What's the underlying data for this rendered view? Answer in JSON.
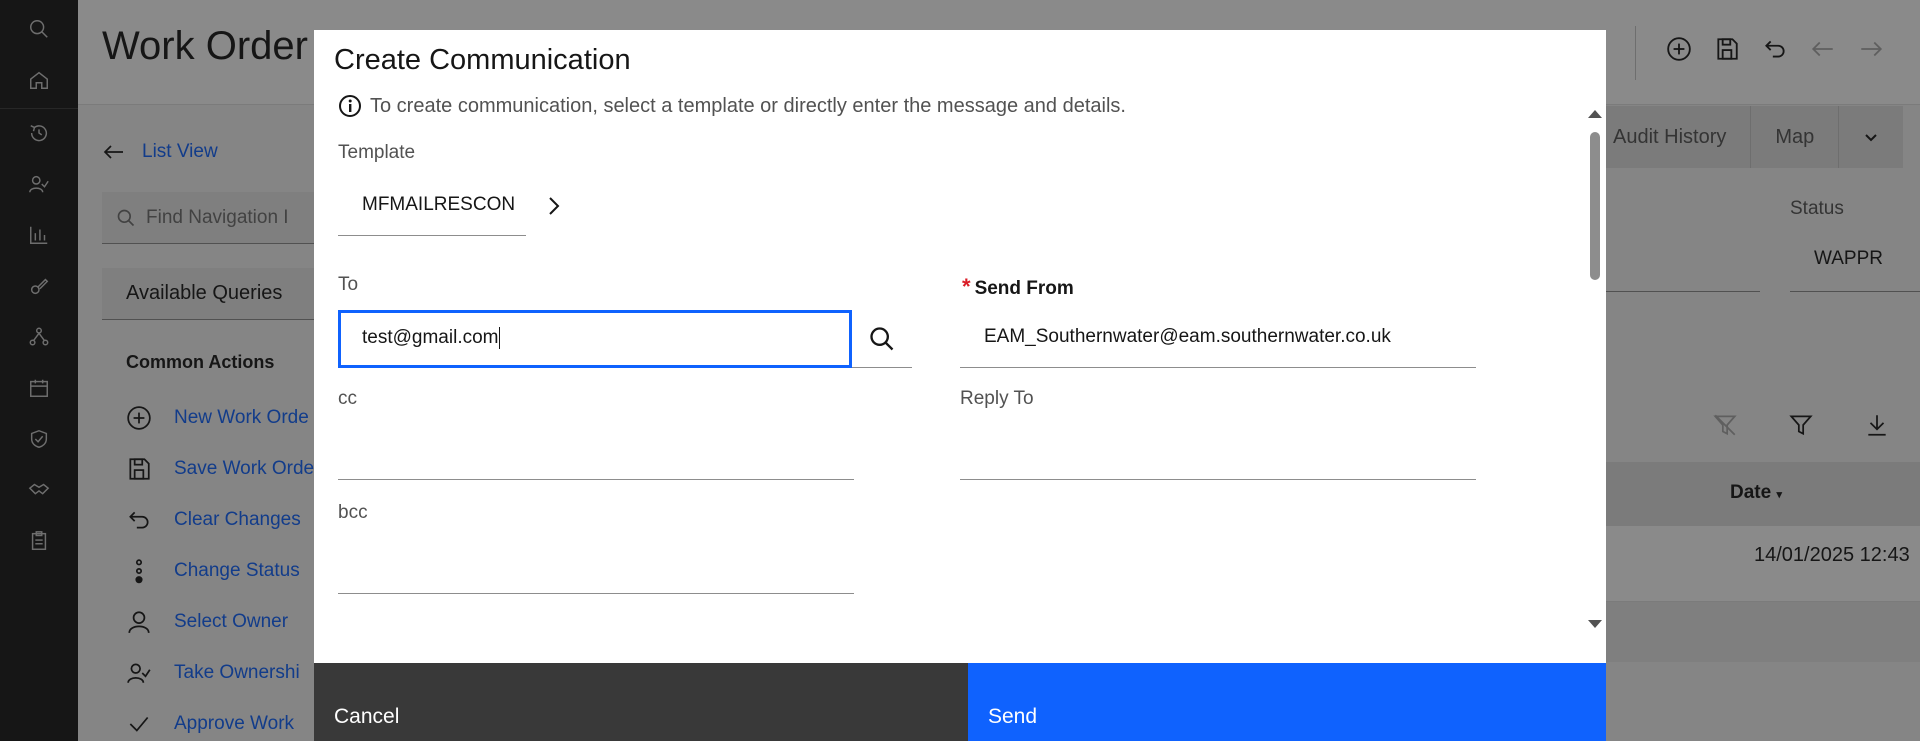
{
  "app": {
    "title": "Work Order",
    "list_view": "List View",
    "find_nav_placeholder": "Find Navigation I",
    "available_queries": "Available Queries",
    "common_actions_title": "Common Actions",
    "common_actions": [
      {
        "label": "New Work Orde",
        "icon": "add-circle-icon"
      },
      {
        "label": "Save Work Orde",
        "icon": "save-icon"
      },
      {
        "label": "Clear Changes",
        "icon": "undo-icon"
      },
      {
        "label": "Change Status",
        "icon": "status-dots-icon"
      },
      {
        "label": "Select Owner",
        "icon": "user-icon"
      },
      {
        "label": "Take Ownershi",
        "icon": "user-check-icon"
      },
      {
        "label": "Approve Work",
        "icon": "checkmark-icon"
      }
    ],
    "tabs": [
      "Audit History",
      "Map"
    ],
    "status_label": "Status",
    "status_value": "WAPPR",
    "grid_header_date": "Date",
    "grid_row_date": "14/01/2025 12:43"
  },
  "modal": {
    "title": "Create Communication",
    "info_text": "To create communication, select a template or directly enter the message and details.",
    "template_label": "Template",
    "template_value": "MFMAILRESCON",
    "to_label": "To",
    "to_value": "test@gmail.com",
    "send_from_label": "Send From",
    "send_from_value": "EAM_Southernwater@eam.southernwater.co.uk",
    "cc_label": "cc",
    "reply_to_label": "Reply To",
    "bcc_label": "bcc",
    "cancel_label": "Cancel",
    "send_label": "Send"
  },
  "colors": {
    "primary": "#0f62fe",
    "required": "#da1e28",
    "secondary_button": "#393939",
    "rail": "#161616"
  }
}
